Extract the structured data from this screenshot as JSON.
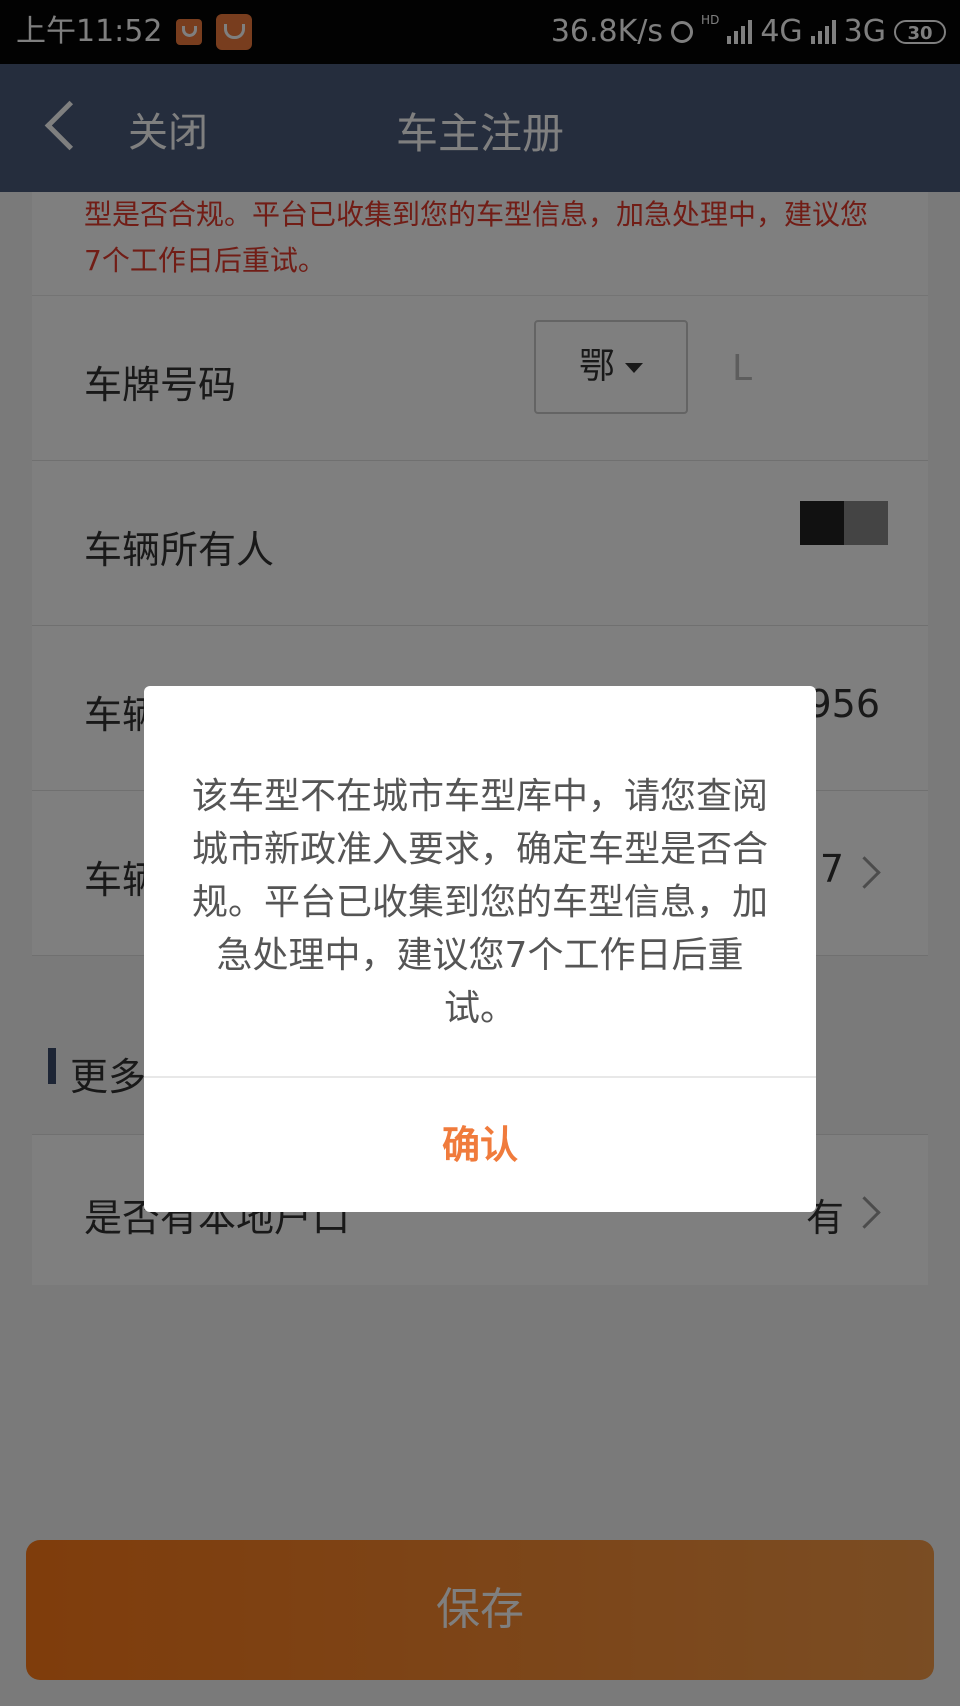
{
  "status_bar": {
    "time": "上午11:52",
    "network_speed": "36.8K/s",
    "hd": "HD",
    "net_4g": "4G",
    "net_3g": "3G",
    "battery": "30"
  },
  "header": {
    "close_label": "关闭",
    "title": "车主注册"
  },
  "form": {
    "warning": "型是否合规。平台已收集到您的车型信息，加急处理中，建议您\n7个工作日后重试。",
    "plate_label": "车牌号码",
    "plate_province": "鄂",
    "plate_input_partial": "L",
    "owner_label": "车辆所有人",
    "row3_label_partial": "车辆",
    "row3_value_partial": "956",
    "row4_label_partial": "车辆",
    "row4_value_partial": "7",
    "section_title_partial": "更多",
    "local_label": "是否有本地户口",
    "local_value": "有"
  },
  "save_label": "保存",
  "dialog": {
    "message": "该车型不在城市车型库中，请您查阅城市新政准入要求，确定车型是否合规。平台已收集到您的车型信息，加急处理中，建议您7个工作日后重试。",
    "confirm_label": "确认"
  },
  "colors": {
    "accent": "#f07b3c",
    "header_bg": "#4a5a7a",
    "warning": "#e33a2c"
  }
}
